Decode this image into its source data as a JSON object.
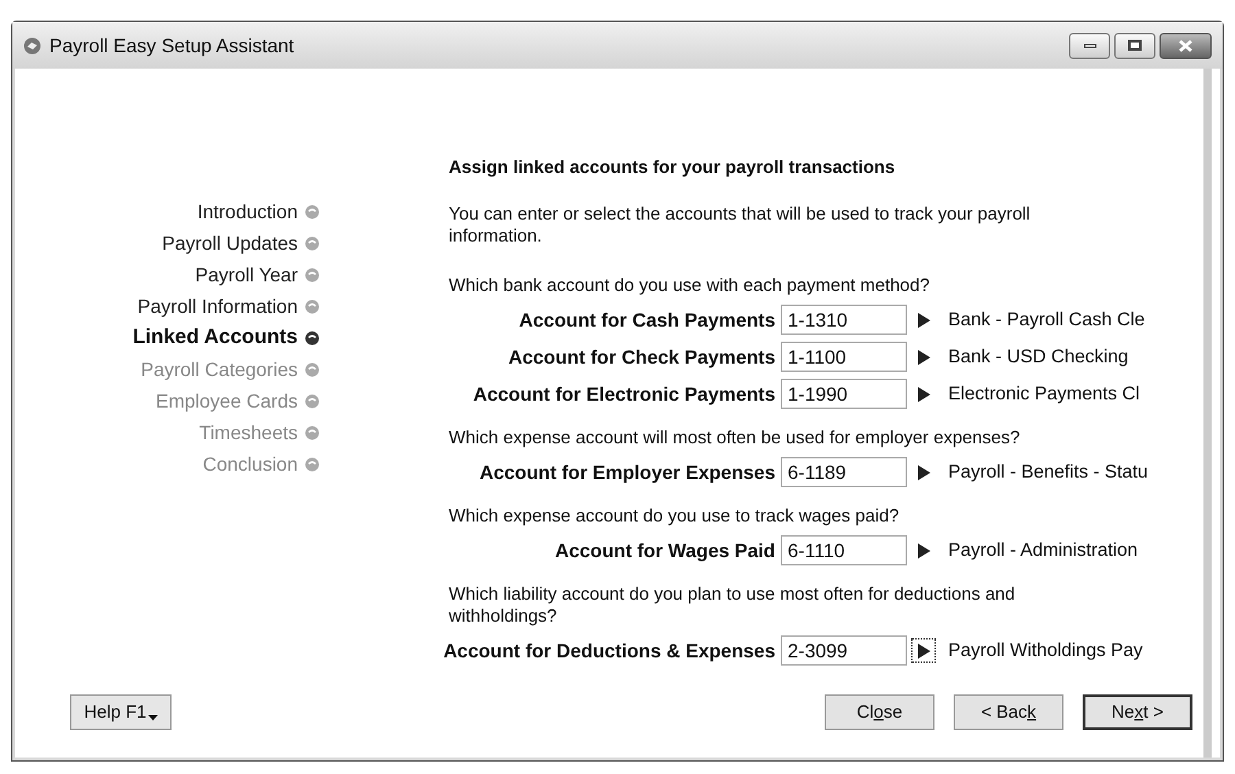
{
  "window": {
    "title": "Payroll Easy Setup Assistant"
  },
  "steps": [
    {
      "label": "Introduction",
      "selected": false,
      "disabled": false
    },
    {
      "label": "Payroll Updates",
      "selected": false,
      "disabled": false
    },
    {
      "label": "Payroll Year",
      "selected": false,
      "disabled": false
    },
    {
      "label": "Payroll Information",
      "selected": false,
      "disabled": false
    },
    {
      "label": "Linked Accounts",
      "selected": true,
      "disabled": false
    },
    {
      "label": "Payroll Categories",
      "selected": false,
      "disabled": true
    },
    {
      "label": "Employee Cards",
      "selected": false,
      "disabled": true
    },
    {
      "label": "Timesheets",
      "selected": false,
      "disabled": true
    },
    {
      "label": "Conclusion",
      "selected": false,
      "disabled": true
    }
  ],
  "heading": "Assign linked accounts for your payroll transactions",
  "intro": "You can enter or select the accounts that will be used to track your payroll information.",
  "sections": [
    {
      "question": "Which bank account do you use with each payment method?",
      "accounts": [
        {
          "label": "Account for Cash Payments",
          "value": "1-1310",
          "description": "Bank - Payroll Cash Cle",
          "focused": false
        },
        {
          "label": "Account for Check Payments",
          "value": "1-1100",
          "description": "Bank - USD Checking",
          "focused": false
        },
        {
          "label": "Account for Electronic Payments",
          "value": "1-1990",
          "description": "Electronic Payments Cl",
          "focused": false
        }
      ]
    },
    {
      "question": "Which expense account will most often be used for employer expenses?",
      "accounts": [
        {
          "label": "Account for Employer Expenses",
          "value": "6-1189",
          "description": "Payroll - Benefits - Statu",
          "focused": false
        }
      ]
    },
    {
      "question": "Which expense account do you use to track wages paid?",
      "accounts": [
        {
          "label": "Account for Wages Paid",
          "value": "6-1110",
          "description": "Payroll - Administration",
          "focused": false
        }
      ]
    },
    {
      "question": "Which liability account do you plan to use most often for deductions and withholdings?",
      "accounts": [
        {
          "label": "Account for Deductions & Expenses",
          "value": "2-3099",
          "description": "Payroll Witholdings Pay",
          "focused": true
        }
      ]
    }
  ],
  "help_button": "Help F1",
  "buttons": [
    {
      "before": "Cl",
      "key": "o",
      "after": "se",
      "default": false
    },
    {
      "before": "< Bac",
      "key": "k",
      "default": false
    },
    {
      "before": "Ne",
      "key": "x",
      "after": "t >",
      "default": true
    }
  ]
}
